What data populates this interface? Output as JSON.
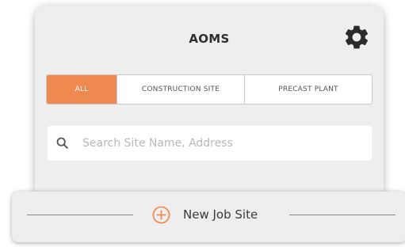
{
  "header": {
    "title": "AOMS",
    "settings_icon": "gear-icon"
  },
  "filter_tabs": {
    "all_label": "ALL",
    "construction_label": "CONSTRUCTION SITE",
    "precast_label": "PRECAST PLANT",
    "selected": "ALL"
  },
  "search": {
    "placeholder": "Search Site Name, Address",
    "value": "",
    "icon": "search-icon"
  },
  "footer": {
    "new_job_label": "New Job Site",
    "icon": "plus-circle-icon"
  },
  "colors": {
    "accent": "#f0894f",
    "panel_bg": "#eeeeee",
    "title_text": "#2e2e2e"
  }
}
